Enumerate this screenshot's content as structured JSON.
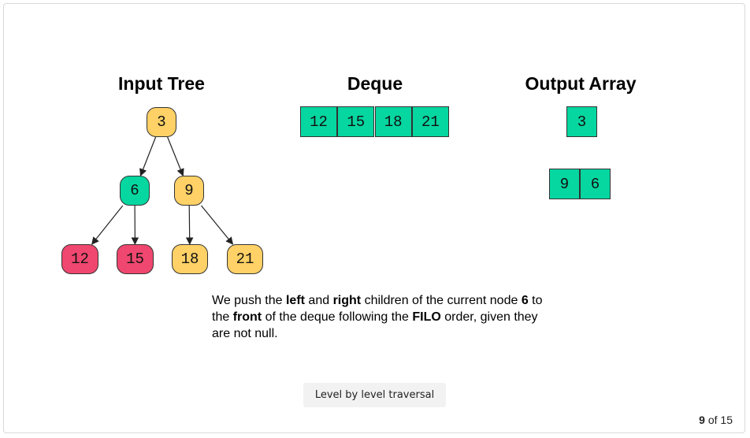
{
  "headings": {
    "input_tree": "Input Tree",
    "deque": "Deque",
    "output_array": "Output Array"
  },
  "colors": {
    "yellow": "#ffd166",
    "green": "#06d6a0",
    "red": "#ef476f"
  },
  "tree": {
    "nodes": [
      {
        "id": "n3",
        "value": "3",
        "color": "yellow"
      },
      {
        "id": "n6",
        "value": "6",
        "color": "green"
      },
      {
        "id": "n9",
        "value": "9",
        "color": "yellow"
      },
      {
        "id": "n12",
        "value": "12",
        "color": "red"
      },
      {
        "id": "n15",
        "value": "15",
        "color": "red"
      },
      {
        "id": "n18",
        "value": "18",
        "color": "yellow"
      },
      {
        "id": "n21",
        "value": "21",
        "color": "yellow"
      }
    ],
    "edges": [
      [
        "n3",
        "n6"
      ],
      [
        "n3",
        "n9"
      ],
      [
        "n6",
        "n12"
      ],
      [
        "n6",
        "n15"
      ],
      [
        "n9",
        "n18"
      ],
      [
        "n9",
        "n21"
      ]
    ]
  },
  "deque": [
    "12",
    "15",
    "18",
    "21"
  ],
  "output": {
    "level1": [
      "3"
    ],
    "level2": [
      "9",
      "6"
    ]
  },
  "caption": {
    "t1": "We push the ",
    "b1": "left",
    "t2": " and ",
    "b2": "right",
    "t3": " children of the current node ",
    "b3": "6",
    "t4": " to the ",
    "b4": "front",
    "t5": " of the deque following the ",
    "b5": "FILO",
    "t6": " order, given they are not null."
  },
  "button_label": "Level by level traversal",
  "pagination": {
    "current": "9",
    "of_label": " of ",
    "total": "15"
  }
}
